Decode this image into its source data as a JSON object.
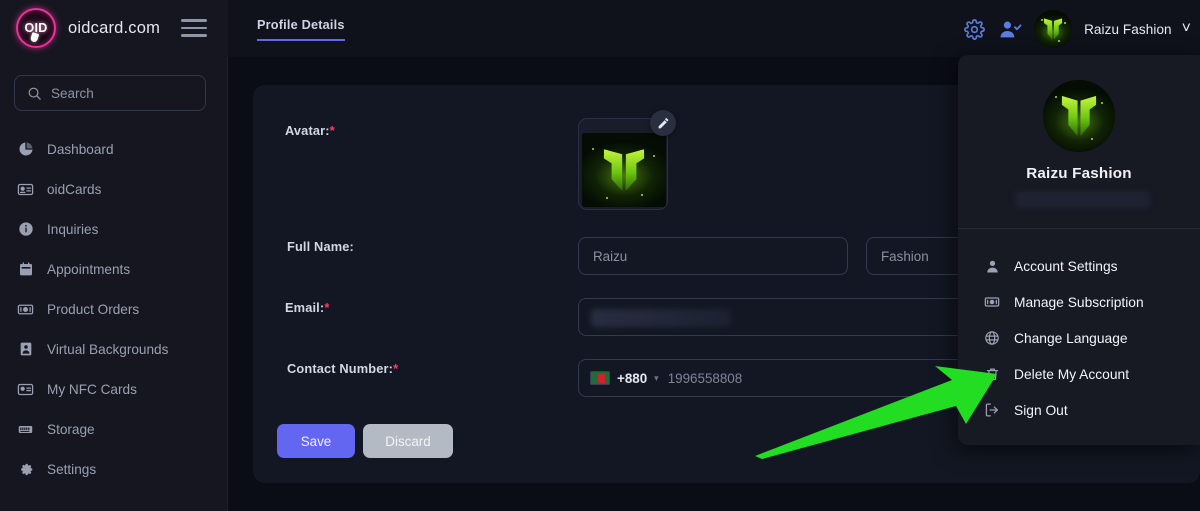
{
  "brand": {
    "logo_text": "OID",
    "name": "oidcard.com",
    "menu_icon": "hamburger-icon"
  },
  "header": {
    "tab_label": "Profile Details",
    "settings_icon": "gear-icon",
    "user_check_icon": "user-check-icon",
    "user_name": "Raizu Fashion",
    "chevron": "˅"
  },
  "sidebar": {
    "search": {
      "placeholder": "Search",
      "icon": "search-icon"
    },
    "items": [
      {
        "label": "Dashboard",
        "icon": "pie-chart-icon"
      },
      {
        "label": "oidCards",
        "icon": "id-card-icon"
      },
      {
        "label": "Inquiries",
        "icon": "info-circle-icon"
      },
      {
        "label": "Appointments",
        "icon": "calendar-icon"
      },
      {
        "label": "Product Orders",
        "icon": "banknote-icon"
      },
      {
        "label": "Virtual Backgrounds",
        "icon": "portrait-icon"
      },
      {
        "label": "My NFC Cards",
        "icon": "nfc-card-icon"
      },
      {
        "label": "Storage",
        "icon": "server-icon"
      },
      {
        "label": "Settings",
        "icon": "gear-icon"
      }
    ]
  },
  "form": {
    "avatar": {
      "label": "Avatar:",
      "required": "*",
      "edit_icon": "pencil-icon"
    },
    "full_name": {
      "label": "Full Name:",
      "first_placeholder": "Raizu",
      "last_placeholder": "Fashion"
    },
    "email": {
      "label": "Email:",
      "required": "*",
      "value_redacted": true
    },
    "contact": {
      "label": "Contact Number:",
      "required": "*",
      "country_code": "+880",
      "flag_icon": "bangladesh-flag-icon",
      "chevron": "▾",
      "placeholder": "1996558808"
    },
    "buttons": {
      "save": "Save",
      "discard": "Discard"
    }
  },
  "dropdown": {
    "user_name": "Raizu Fashion",
    "email_redacted": true,
    "items": [
      {
        "label": "Account Settings",
        "icon": "person-icon"
      },
      {
        "label": "Manage Subscription",
        "icon": "card-money-icon"
      },
      {
        "label": "Change Language",
        "icon": "globe-icon"
      },
      {
        "label": "Delete My Account",
        "icon": "trash-icon"
      },
      {
        "label": "Sign Out",
        "icon": "sign-out-icon"
      }
    ]
  },
  "annotation": {
    "type": "arrow",
    "color": "#22dd22",
    "points_to": "Delete My Account"
  },
  "colors": {
    "accent": "#6366f1",
    "brand_pink": "#e8339b",
    "required_red": "#ff3b5c",
    "arrow_green": "#22dd22",
    "sidebar_bg": "#15161f",
    "main_bg": "#0a0c16",
    "panel_bg": "#131723"
  }
}
